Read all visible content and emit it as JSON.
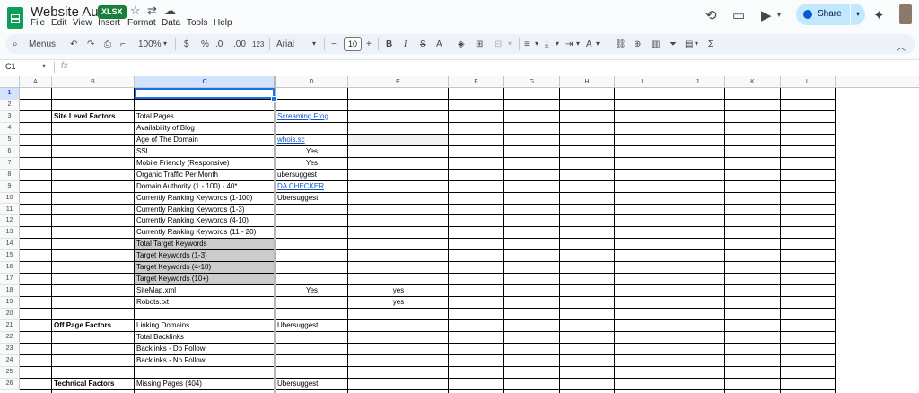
{
  "app": {
    "title": "Website Audit",
    "badge": "XLSX",
    "menu": [
      "File",
      "Edit",
      "View",
      "Insert",
      "Format",
      "Data",
      "Tools",
      "Help"
    ],
    "share_label": "Share"
  },
  "toolbar": {
    "menus_label": "Menus",
    "zoom": "100%",
    "currency": "$",
    "percent": "%",
    "decimal_decrease": ".0",
    "decimal_increase": ".00",
    "number_format": "123",
    "font": "Arial",
    "font_size": "10"
  },
  "formula_bar": {
    "name_box": "C1",
    "fx": "fx"
  },
  "columns": [
    "A",
    "B",
    "C",
    "D",
    "E",
    "F",
    "G",
    "H",
    "I",
    "J",
    "K",
    "L"
  ],
  "rows": [
    "1",
    "2",
    "3",
    "4",
    "5",
    "6",
    "7",
    "8",
    "9",
    "10",
    "11",
    "12",
    "13",
    "14",
    "15",
    "16",
    "17",
    "18",
    "19",
    "20",
    "21",
    "22",
    "23",
    "24",
    "25",
    "26"
  ],
  "cells": {
    "r3": {
      "B": "Site Level Factors",
      "C": "Total Pages",
      "D": "Screaming Frog"
    },
    "r4": {
      "C": "Availability of Blog"
    },
    "r5": {
      "C": "Age of The Domain",
      "D": "whois.sc"
    },
    "r6": {
      "C": "SSL",
      "D": "Yes"
    },
    "r7": {
      "C": "Mobile Friendly (Responsive)",
      "D": "Yes"
    },
    "r8": {
      "C": "Organic Traffic Per Month",
      "D": "ubersuggest"
    },
    "r9": {
      "C": "Domain Authority (1 - 100) - 40*",
      "D": "DA CHECKER"
    },
    "r10": {
      "C": "Currently Ranking Keywords (1-100)",
      "D": "Ubersuggest"
    },
    "r11": {
      "C": "Currently Ranking Keywords (1-3)"
    },
    "r12": {
      "C": "Currently Ranking Keywords (4-10)"
    },
    "r13": {
      "C": "Currently  Ranking Keywords (11 - 20)"
    },
    "r14": {
      "C": "Total Target Keywords"
    },
    "r15": {
      "C": "Target Keywords (1-3)"
    },
    "r16": {
      "C": "Target Keywords (4-10)"
    },
    "r17": {
      "C": "Target Keywords (10+)"
    },
    "r18": {
      "C": "SiteMap.xml",
      "D": "Yes",
      "E": "yes"
    },
    "r19": {
      "C": "Robots.txt",
      "E": "yes"
    },
    "r21": {
      "B": "Off Page Factors",
      "C": "Linking Domains",
      "D": "Ubersuggest"
    },
    "r22": {
      "C": "Total Backlinks"
    },
    "r23": {
      "C": "Backlinks - Do Follow"
    },
    "r24": {
      "C": "Backlinks - No Follow"
    },
    "r26": {
      "B": "Technical Factors",
      "C": "Missing Pages (404)",
      "D": "Ubersuggest"
    }
  },
  "colors": {
    "accent": "#0b57d0",
    "share_bg": "#c2e7ff",
    "sheets_green": "#0f9d58",
    "selection": "#1a73e8",
    "gray_fill": "#cccccc"
  }
}
